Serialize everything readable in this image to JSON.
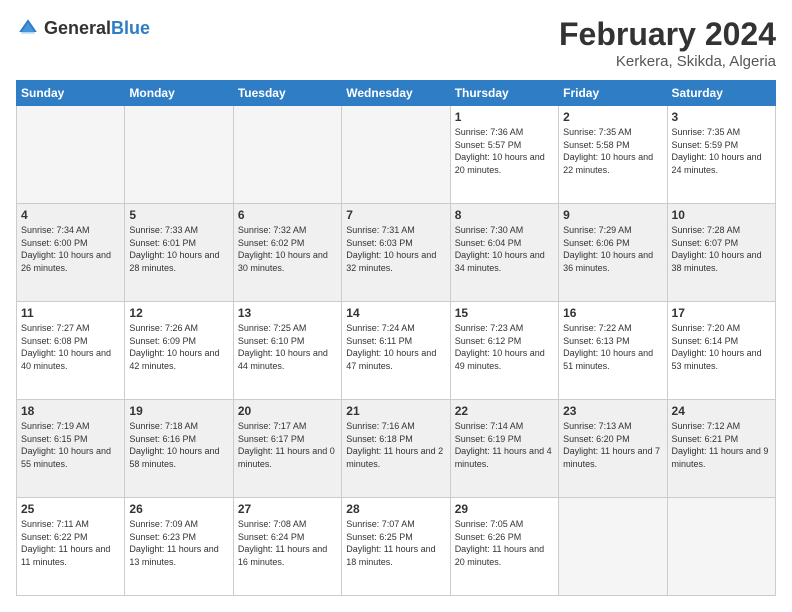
{
  "header": {
    "logo_general": "General",
    "logo_blue": "Blue",
    "title": "February 2024",
    "location": "Kerkera, Skikda, Algeria"
  },
  "days_of_week": [
    "Sunday",
    "Monday",
    "Tuesday",
    "Wednesday",
    "Thursday",
    "Friday",
    "Saturday"
  ],
  "weeks": [
    {
      "shaded": false,
      "days": [
        {
          "num": "",
          "info": ""
        },
        {
          "num": "",
          "info": ""
        },
        {
          "num": "",
          "info": ""
        },
        {
          "num": "",
          "info": ""
        },
        {
          "num": "1",
          "info": "Sunrise: 7:36 AM\nSunset: 5:57 PM\nDaylight: 10 hours and 20 minutes."
        },
        {
          "num": "2",
          "info": "Sunrise: 7:35 AM\nSunset: 5:58 PM\nDaylight: 10 hours and 22 minutes."
        },
        {
          "num": "3",
          "info": "Sunrise: 7:35 AM\nSunset: 5:59 PM\nDaylight: 10 hours and 24 minutes."
        }
      ]
    },
    {
      "shaded": true,
      "days": [
        {
          "num": "4",
          "info": "Sunrise: 7:34 AM\nSunset: 6:00 PM\nDaylight: 10 hours and 26 minutes."
        },
        {
          "num": "5",
          "info": "Sunrise: 7:33 AM\nSunset: 6:01 PM\nDaylight: 10 hours and 28 minutes."
        },
        {
          "num": "6",
          "info": "Sunrise: 7:32 AM\nSunset: 6:02 PM\nDaylight: 10 hours and 30 minutes."
        },
        {
          "num": "7",
          "info": "Sunrise: 7:31 AM\nSunset: 6:03 PM\nDaylight: 10 hours and 32 minutes."
        },
        {
          "num": "8",
          "info": "Sunrise: 7:30 AM\nSunset: 6:04 PM\nDaylight: 10 hours and 34 minutes."
        },
        {
          "num": "9",
          "info": "Sunrise: 7:29 AM\nSunset: 6:06 PM\nDaylight: 10 hours and 36 minutes."
        },
        {
          "num": "10",
          "info": "Sunrise: 7:28 AM\nSunset: 6:07 PM\nDaylight: 10 hours and 38 minutes."
        }
      ]
    },
    {
      "shaded": false,
      "days": [
        {
          "num": "11",
          "info": "Sunrise: 7:27 AM\nSunset: 6:08 PM\nDaylight: 10 hours and 40 minutes."
        },
        {
          "num": "12",
          "info": "Sunrise: 7:26 AM\nSunset: 6:09 PM\nDaylight: 10 hours and 42 minutes."
        },
        {
          "num": "13",
          "info": "Sunrise: 7:25 AM\nSunset: 6:10 PM\nDaylight: 10 hours and 44 minutes."
        },
        {
          "num": "14",
          "info": "Sunrise: 7:24 AM\nSunset: 6:11 PM\nDaylight: 10 hours and 47 minutes."
        },
        {
          "num": "15",
          "info": "Sunrise: 7:23 AM\nSunset: 6:12 PM\nDaylight: 10 hours and 49 minutes."
        },
        {
          "num": "16",
          "info": "Sunrise: 7:22 AM\nSunset: 6:13 PM\nDaylight: 10 hours and 51 minutes."
        },
        {
          "num": "17",
          "info": "Sunrise: 7:20 AM\nSunset: 6:14 PM\nDaylight: 10 hours and 53 minutes."
        }
      ]
    },
    {
      "shaded": true,
      "days": [
        {
          "num": "18",
          "info": "Sunrise: 7:19 AM\nSunset: 6:15 PM\nDaylight: 10 hours and 55 minutes."
        },
        {
          "num": "19",
          "info": "Sunrise: 7:18 AM\nSunset: 6:16 PM\nDaylight: 10 hours and 58 minutes."
        },
        {
          "num": "20",
          "info": "Sunrise: 7:17 AM\nSunset: 6:17 PM\nDaylight: 11 hours and 0 minutes."
        },
        {
          "num": "21",
          "info": "Sunrise: 7:16 AM\nSunset: 6:18 PM\nDaylight: 11 hours and 2 minutes."
        },
        {
          "num": "22",
          "info": "Sunrise: 7:14 AM\nSunset: 6:19 PM\nDaylight: 11 hours and 4 minutes."
        },
        {
          "num": "23",
          "info": "Sunrise: 7:13 AM\nSunset: 6:20 PM\nDaylight: 11 hours and 7 minutes."
        },
        {
          "num": "24",
          "info": "Sunrise: 7:12 AM\nSunset: 6:21 PM\nDaylight: 11 hours and 9 minutes."
        }
      ]
    },
    {
      "shaded": false,
      "days": [
        {
          "num": "25",
          "info": "Sunrise: 7:11 AM\nSunset: 6:22 PM\nDaylight: 11 hours and 11 minutes."
        },
        {
          "num": "26",
          "info": "Sunrise: 7:09 AM\nSunset: 6:23 PM\nDaylight: 11 hours and 13 minutes."
        },
        {
          "num": "27",
          "info": "Sunrise: 7:08 AM\nSunset: 6:24 PM\nDaylight: 11 hours and 16 minutes."
        },
        {
          "num": "28",
          "info": "Sunrise: 7:07 AM\nSunset: 6:25 PM\nDaylight: 11 hours and 18 minutes."
        },
        {
          "num": "29",
          "info": "Sunrise: 7:05 AM\nSunset: 6:26 PM\nDaylight: 11 hours and 20 minutes."
        },
        {
          "num": "",
          "info": ""
        },
        {
          "num": "",
          "info": ""
        }
      ]
    }
  ]
}
